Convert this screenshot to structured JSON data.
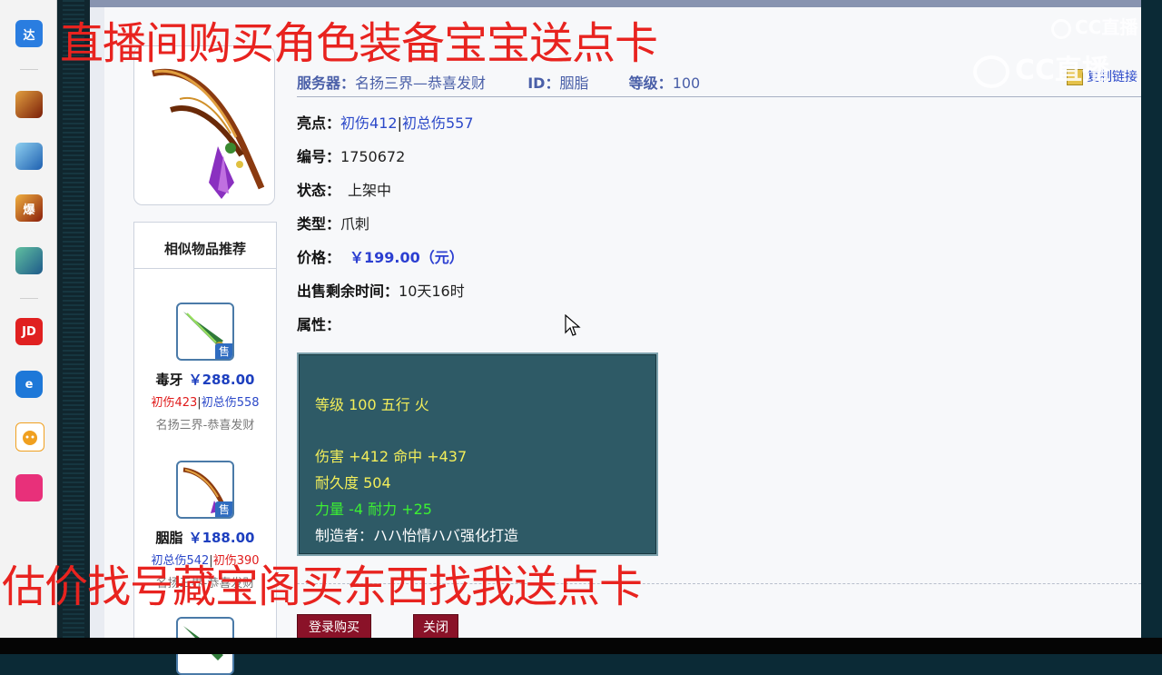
{
  "overlay": {
    "top_text": "直播间购买角色装备宝宝送点卡",
    "bottom_text": "估价找号藏宝阁买东西找我送点卡",
    "watermark_small": "CC直播",
    "watermark_large": "CC直播"
  },
  "taskbar": {
    "items": [
      {
        "name": "da-app-icon",
        "glyph": "达",
        "color": "#2a7de0"
      },
      {
        "name": "game-icon-1",
        "glyph": "",
        "color": "#a03010"
      },
      {
        "name": "game-icon-2",
        "glyph": "",
        "color": "#3a8fd0"
      },
      {
        "name": "game-icon-3",
        "glyph": "爆",
        "color": "#b8300c"
      },
      {
        "name": "game-icon-4",
        "glyph": "",
        "color": "#2e8a6a"
      },
      {
        "name": "jd-icon",
        "glyph": "JD",
        "color": "#e02020"
      },
      {
        "name": "browser-icon",
        "glyph": "e",
        "color": "#1e78d8"
      },
      {
        "name": "fox-icon",
        "glyph": "",
        "color": "#f0a020"
      },
      {
        "name": "shop-icon",
        "glyph": "",
        "color": "#e8307a"
      }
    ]
  },
  "header": {
    "server_label": "服务器：",
    "server_value": "名扬三界—恭喜发财",
    "id_label": "ID：",
    "id_value": "胭脂",
    "level_label": "等级：",
    "level_value": "100",
    "copy_label": "复制链接"
  },
  "details": {
    "highlight_label": "亮点：",
    "highlight_value_1": "初伤412",
    "highlight_sep": "|",
    "highlight_value_2": "初总伤557",
    "number_label": "编号：",
    "number_value": "1750672",
    "status_label": "状态：",
    "status_value": "上架中",
    "type_label": "类型：",
    "type_value": "爪刺",
    "price_label": "价格：",
    "price_value": "￥199.00（元）",
    "remaining_label": "出售剩余时间：",
    "remaining_value": "10天16时",
    "attr_label": "属性："
  },
  "attributes": {
    "line1": "等级 100 五行 火",
    "line2": "伤害 +412 命中 +437",
    "line3": "耐久度 504",
    "line4": "力量 -4 耐力 +25",
    "line5": "制造者：ハハ怡情ハバ强化打造"
  },
  "recommend": {
    "title": "相似物品推荐",
    "sale_badge": "售",
    "items": [
      {
        "name": "毒牙",
        "price": "￥288.00",
        "stat1": "初伤423",
        "sep": "|",
        "stat2": "初总伤558",
        "server": "名扬三界-恭喜发财"
      },
      {
        "name": "胭脂",
        "price": "￥188.00",
        "stat1": "初总伤542",
        "sep": "|",
        "stat2": "初伤390",
        "server": "名扬三界-恭喜发财"
      }
    ]
  },
  "buttons": {
    "login_buy": "登录购买",
    "close": "关闭"
  }
}
